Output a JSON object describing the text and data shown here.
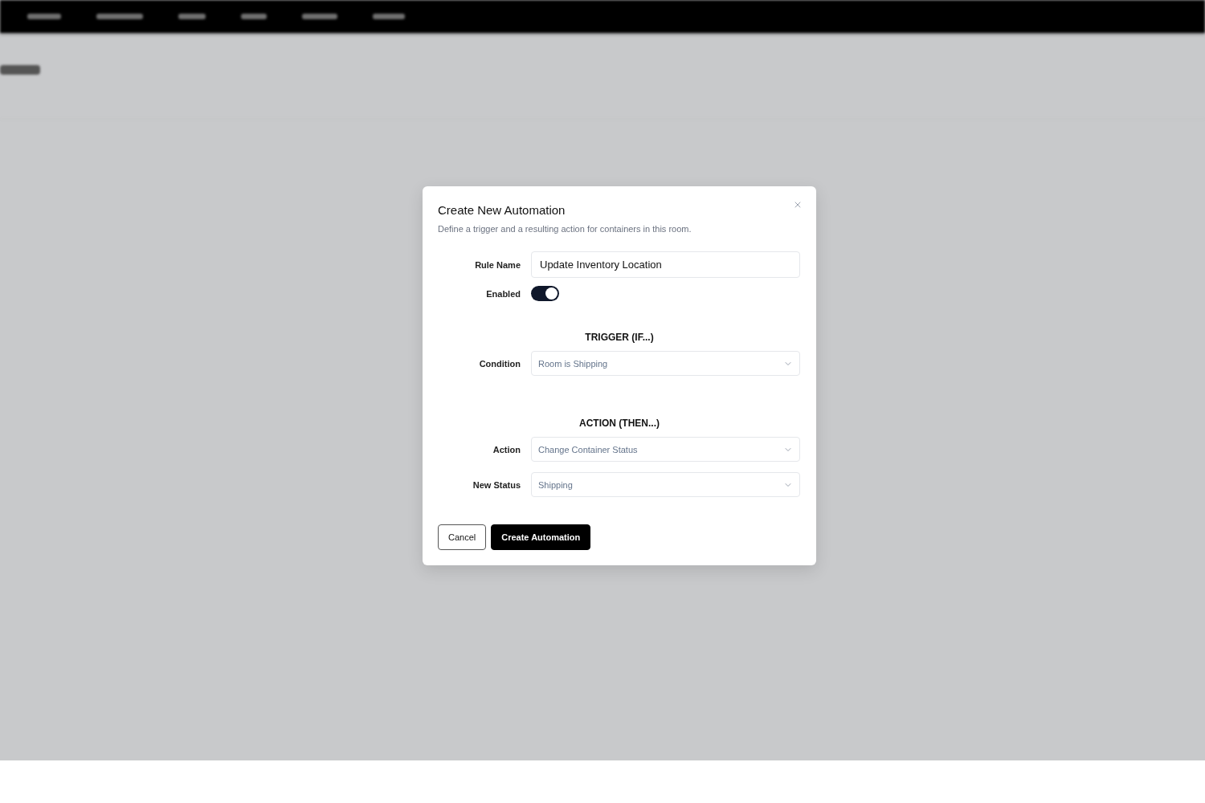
{
  "dialog": {
    "title": "Create New Automation",
    "description": "Define a trigger and a resulting action for containers in this room.",
    "rows": [
      {
        "kind": "text",
        "label": "Rule Name",
        "value": "Update Inventory Location"
      },
      {
        "kind": "toggle",
        "label": "Enabled",
        "on": true
      },
      {
        "kind": "heading",
        "label": "TRIGGER (IF...)"
      },
      {
        "kind": "select",
        "label": "Condition",
        "value": "Room is Shipping"
      },
      {
        "kind": "heading",
        "label": "ACTION (THEN...)"
      },
      {
        "kind": "select",
        "label": "Action",
        "value": "Change Container Status"
      },
      {
        "kind": "select",
        "label": "New Status",
        "value": "Shipping"
      }
    ],
    "buttons": [
      {
        "label": "Cancel",
        "kind": "secondary"
      },
      {
        "label": "Create Automation",
        "kind": "primary"
      }
    ]
  }
}
